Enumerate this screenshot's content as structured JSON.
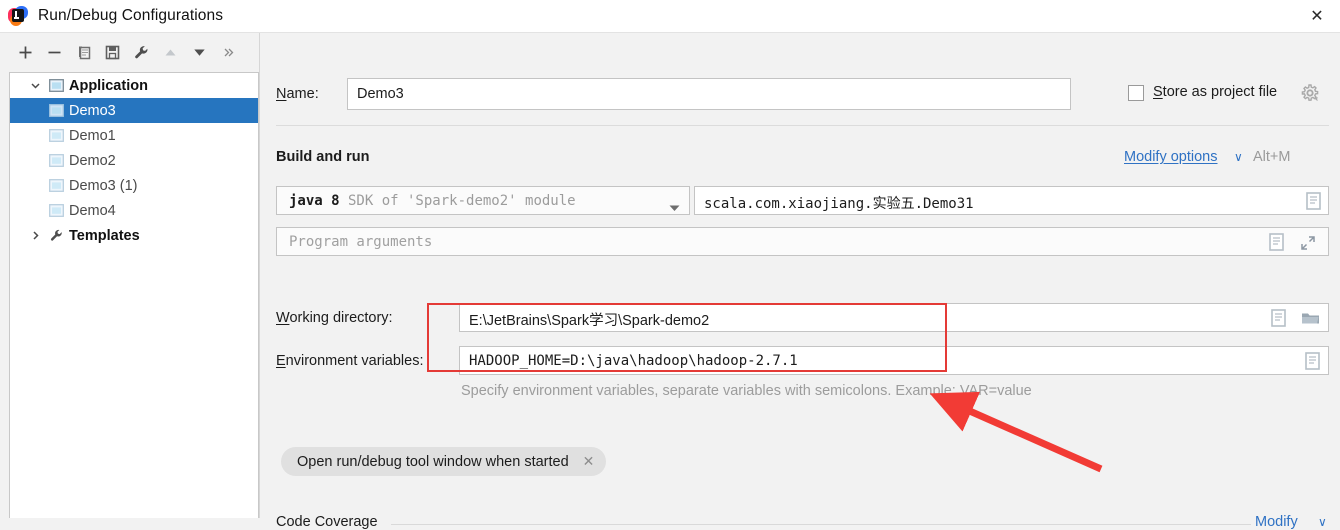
{
  "window": {
    "title": "Run/Debug Configurations",
    "close_label": "✕",
    "logo_icon": "intellij-idea-logo"
  },
  "toolbar": {
    "items": [
      {
        "name": "add-button",
        "icon": "plus-icon",
        "label": "+",
        "enabled": true
      },
      {
        "name": "remove-button",
        "icon": "minus-icon",
        "label": "−",
        "enabled": true
      },
      {
        "name": "copy-button",
        "icon": "copy-icon",
        "label": "Copy",
        "enabled": true
      },
      {
        "name": "save-button",
        "icon": "save-icon",
        "label": "Save",
        "enabled": true
      },
      {
        "name": "edit-templates-button",
        "icon": "wrench-icon",
        "label": "Edit templates",
        "enabled": true
      },
      {
        "name": "move-up-button",
        "icon": "arrow-up-icon",
        "label": "Move up",
        "enabled": false
      },
      {
        "name": "move-down-button",
        "icon": "arrow-down-icon",
        "label": "Move down",
        "enabled": true
      },
      {
        "name": "more-button",
        "icon": "chevron-double-right-icon",
        "label": "»",
        "enabled": true
      }
    ]
  },
  "tree": {
    "nodes": [
      {
        "label": "Application",
        "type": "group",
        "expanded": true,
        "selected": false,
        "icon": "application-icon"
      },
      {
        "label": "Demo3",
        "type": "child",
        "selected": true,
        "icon": "run-config-icon"
      },
      {
        "label": "Demo1",
        "type": "child",
        "selected": false,
        "icon": "run-config-icon"
      },
      {
        "label": "Demo2",
        "type": "child",
        "selected": false,
        "icon": "run-config-icon"
      },
      {
        "label": "Demo3 (1)",
        "type": "child",
        "selected": false,
        "icon": "run-config-icon"
      },
      {
        "label": "Demo4",
        "type": "child",
        "selected": false,
        "icon": "run-config-icon"
      },
      {
        "label": "Templates",
        "type": "group",
        "expanded": false,
        "selected": false,
        "icon": "wrench-icon"
      }
    ]
  },
  "form": {
    "name_label": "Name:",
    "name_value": "Demo3",
    "store_as_project_file_label": "Store as project file",
    "store_as_project_file_checked": false,
    "gear_icon": "gear-icon",
    "build_and_run_title": "Build and run",
    "modify_options_label": "Modify options",
    "modify_options_caret": "∨",
    "modify_options_shortcut": "Alt+M",
    "jdk_prefix": "java 8",
    "jdk_suffix": " SDK of 'Spark-demo2' module",
    "main_class_value": "scala.com.xiaojiang.实验五.Demo31",
    "program_arguments_placeholder": "Program arguments",
    "working_directory_label": "Working directory:",
    "working_directory_value": "E:\\JetBrains\\Spark学习\\Spark-demo2",
    "environment_variables_label": "Environment variables:",
    "environment_variables_value": "HADOOP_HOME=D:\\java\\hadoop\\hadoop-2.7.1",
    "environment_variables_hint": "Specify environment variables, separate variables with semicolons. Example: VAR=value",
    "chip_label": "Open run/debug tool window when started",
    "chip_close": "✕",
    "code_coverage_title": "Code Coverage",
    "code_coverage_modify_label": "Modify",
    "code_coverage_modify_caret": "∨"
  },
  "annotations": {
    "highlight_color": "#e43a36",
    "arrow_color": "#f23b35",
    "highlight_target": "environment-variables-row",
    "arrow_points_to": "environment-variables-row"
  },
  "colors": {
    "selection_blue": "#2675bf",
    "link_blue": "#2f72c4",
    "panel_background": "#f2f2f2",
    "field_background": "#ffffff"
  }
}
